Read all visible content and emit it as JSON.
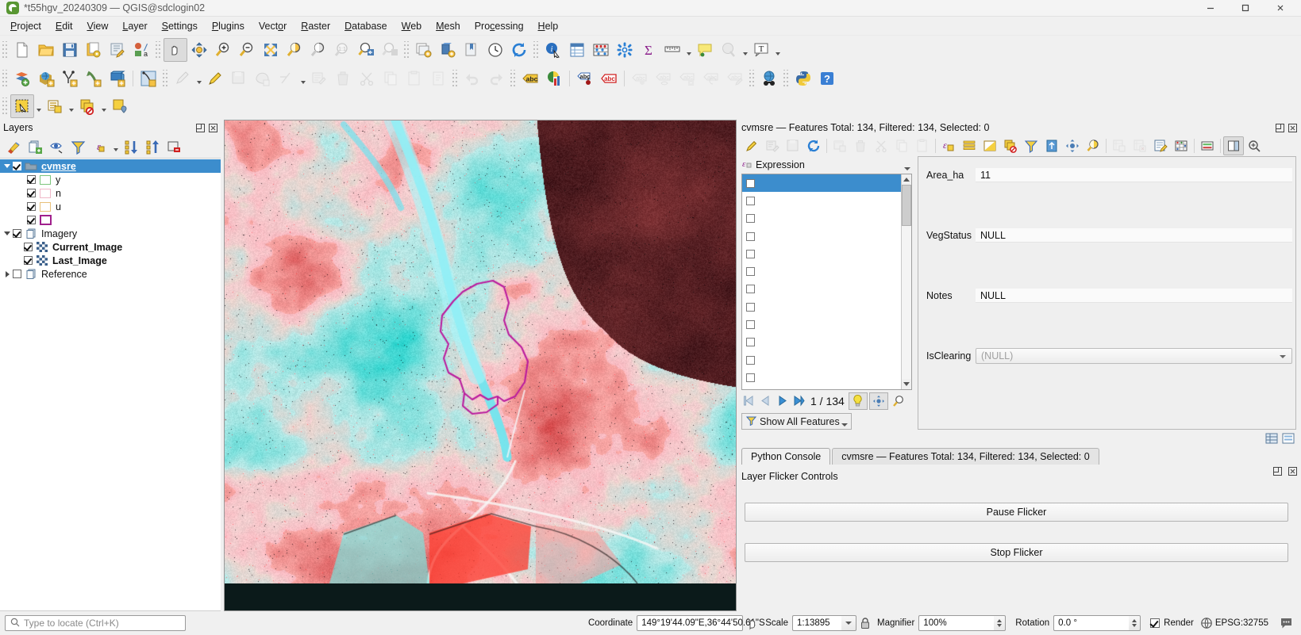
{
  "window": {
    "title": "*t55hgv_20240309 — QGIS@sdclogin02",
    "logo_icon": "qgis-logo-icon",
    "minimize_icon": "minimize-icon",
    "maximize_icon": "maximize-icon",
    "close_icon": "close-icon"
  },
  "menubar": {
    "items": [
      {
        "label": "Project"
      },
      {
        "label": "Edit"
      },
      {
        "label": "View"
      },
      {
        "label": "Layer"
      },
      {
        "label": "Settings"
      },
      {
        "label": "Plugins"
      },
      {
        "label": "Vector"
      },
      {
        "label": "Raster"
      },
      {
        "label": "Database"
      },
      {
        "label": "Web"
      },
      {
        "label": "Mesh"
      },
      {
        "label": "Processing"
      },
      {
        "label": "Help"
      }
    ]
  },
  "layers_panel": {
    "title": "Layers",
    "undock_icon": "undock-icon",
    "close_icon": "close-panel-icon",
    "toolbar": [
      {
        "icon": "open-layer-styling-icon"
      },
      {
        "icon": "add-group-icon"
      },
      {
        "icon": "manage-map-themes-icon"
      },
      {
        "icon": "filter-legend-icon"
      },
      {
        "icon": "filter-legend-expression-icon"
      },
      {
        "icon": "expand-all-icon"
      },
      {
        "icon": "collapse-all-icon"
      },
      {
        "icon": "remove-layer-icon"
      }
    ],
    "tree": [
      {
        "label": "cvmsre",
        "type": "vector",
        "checked": true,
        "selected": true,
        "expanded": true,
        "level": 0,
        "icon": "vector-layer-icon"
      },
      {
        "label": "y",
        "type": "symbol",
        "checked": true,
        "level": 1,
        "stroke": "#7cc47c"
      },
      {
        "label": "n",
        "type": "symbol",
        "checked": true,
        "level": 1,
        "stroke": "#f0b8c8"
      },
      {
        "label": "u",
        "type": "symbol",
        "checked": true,
        "level": 1,
        "stroke": "#e8c07a"
      },
      {
        "label": "",
        "type": "symbol",
        "checked": true,
        "level": 1,
        "stroke": "#a0208c"
      },
      {
        "label": "Imagery",
        "type": "group",
        "checked": true,
        "expanded": true,
        "level": 0,
        "icon": "group-icon"
      },
      {
        "label": "Current_Image",
        "type": "raster",
        "checked": true,
        "level": 1,
        "bold": true,
        "icon": "raster-layer-icon"
      },
      {
        "label": "Last_Image",
        "type": "raster",
        "checked": true,
        "level": 1,
        "bold": true,
        "icon": "raster-layer-icon"
      },
      {
        "label": "Reference",
        "type": "group",
        "checked": false,
        "expanded": false,
        "level": 0,
        "icon": "group-icon"
      }
    ]
  },
  "attribute_dock": {
    "title": "cvmsre — Features Total: 134, Filtered: 134, Selected: 0",
    "undock_icon": "undock-icon",
    "close_icon": "close-panel-icon",
    "toolbar": [
      {
        "icon": "toggle-editing-icon",
        "enabled": true
      },
      {
        "icon": "save-edits-icon",
        "enabled": false
      },
      {
        "icon": "save-layer-edits-icon",
        "enabled": false
      },
      {
        "icon": "reload-table-icon",
        "enabled": true
      },
      {
        "icon": "add-feature-icon",
        "enabled": false
      },
      {
        "icon": "delete-selected-icon",
        "enabled": false
      },
      {
        "icon": "cut-features-icon",
        "enabled": false
      },
      {
        "icon": "copy-features-icon",
        "enabled": false
      },
      {
        "icon": "paste-features-icon",
        "enabled": false
      },
      {
        "icon": "select-by-expression-icon",
        "enabled": true
      },
      {
        "icon": "select-all-icon",
        "enabled": true
      },
      {
        "icon": "invert-selection-icon",
        "enabled": true
      },
      {
        "icon": "deselect-all-icon",
        "enabled": true
      },
      {
        "icon": "filter-features-icon",
        "enabled": true
      },
      {
        "icon": "move-selection-to-top-icon",
        "enabled": true
      },
      {
        "icon": "pan-map-to-feature-icon",
        "enabled": true
      },
      {
        "icon": "zoom-to-selection-icon",
        "enabled": true
      },
      {
        "icon": "new-field-icon",
        "enabled": false
      },
      {
        "icon": "delete-field-icon",
        "enabled": false
      },
      {
        "icon": "field-calculator-icon",
        "enabled": true
      },
      {
        "icon": "conditional-formatting-icon",
        "enabled": true
      },
      {
        "icon": "form-view-icon",
        "enabled": true
      },
      {
        "icon": "dock-toggle-icon",
        "enabled": true
      }
    ],
    "expression_label": "Expression",
    "expression_icon": "expression-icon",
    "feature_rows": 12,
    "selected_row_index": 0,
    "navigation": {
      "first_icon": "first-feature-icon",
      "previous_icon": "previous-feature-icon",
      "next_icon": "next-feature-icon",
      "last_icon": "last-feature-icon",
      "counter": "1 / 134",
      "highlight_icon": "bulb-icon",
      "pan_icon": "pan-to-feature-icon",
      "zoom_icon": "zoom-to-feature-icon"
    },
    "show_all_features": {
      "label": "Show All Features",
      "icon": "filter-icon"
    },
    "form": {
      "fields": [
        {
          "label": "Area_ha",
          "value": "11",
          "type": "text"
        },
        {
          "label": "VegStatus",
          "value": "NULL",
          "type": "text"
        },
        {
          "label": "Notes",
          "value": "NULL",
          "type": "text"
        },
        {
          "label": "IsClearing",
          "value": "(NULL)",
          "type": "combo",
          "placeholder": true
        }
      ]
    },
    "bottom_icons": [
      {
        "icon": "table-view-icon"
      },
      {
        "icon": "form-view-icon"
      }
    ]
  },
  "bottom_tabs": {
    "tabs": [
      {
        "label": "Python Console",
        "active": false
      },
      {
        "label": "cvmsre — Features Total: 134, Filtered: 134, Selected: 0",
        "active": true
      }
    ]
  },
  "flicker_panel": {
    "title": "Layer Flicker Controls",
    "pause_button": "Pause Flicker",
    "stop_button": "Stop Flicker",
    "undock_icon": "undock-icon",
    "close_icon": "close-panel-icon"
  },
  "statusbar": {
    "locator_placeholder": "Type to locate (Ctrl+K)",
    "locator_icon": "search-icon",
    "coordinate_label": "Coordinate",
    "coordinate_value": "149°19'44.09\"E,36°44'50.61\"S",
    "coordinate_toggle_icon": "coordinate-capture-icon",
    "scale_label": "Scale",
    "scale_value": "1:13895",
    "lock_icon": "lock-scale-icon",
    "magnifier_label": "Magnifier",
    "magnifier_value": "100%",
    "rotation_label": "Rotation",
    "rotation_value": "0.0 °",
    "render_label": "Render",
    "render_checked": true,
    "crs_label": "EPSG:32755",
    "crs_icon": "crs-globe-icon",
    "messages_icon": "messages-icon"
  },
  "toolbars": {
    "row1": [
      {
        "icon": "new-project-icon"
      },
      {
        "icon": "open-project-icon"
      },
      {
        "icon": "save-project-icon"
      },
      {
        "icon": "new-print-layout-icon"
      },
      {
        "icon": "style-manager-icon"
      },
      {
        "icon": "data-source-manager-icon"
      },
      {
        "icon": "pan-map-icon",
        "active": true
      },
      {
        "icon": "pan-to-selection-icon"
      },
      {
        "icon": "zoom-in-icon"
      },
      {
        "icon": "zoom-out-icon"
      },
      {
        "icon": "zoom-full-icon"
      },
      {
        "icon": "zoom-to-selection-icon"
      },
      {
        "icon": "zoom-to-layer-icon"
      },
      {
        "icon": "zoom-native-icon",
        "enabled": false
      },
      {
        "icon": "zoom-last-icon"
      },
      {
        "icon": "zoom-next-icon",
        "enabled": false
      },
      {
        "icon": "new-map-view-icon"
      },
      {
        "icon": "new-3d-map-view-icon"
      },
      {
        "icon": "show-bookmarks-icon"
      },
      {
        "icon": "temporal-controller-icon"
      },
      {
        "icon": "refresh-icon"
      },
      {
        "icon": "identify-features-icon"
      },
      {
        "icon": "open-attribute-table-icon"
      },
      {
        "icon": "statistical-summary-icon"
      },
      {
        "icon": "processing-toolbox-icon"
      },
      {
        "icon": "sum-icon"
      },
      {
        "icon": "measure-line-icon"
      },
      {
        "icon": "map-tips-icon"
      },
      {
        "icon": "annotations-icon",
        "enabled": false
      },
      {
        "icon": "text-annotation-icon"
      }
    ],
    "row2": [
      {
        "icon": "add-vector-layer-icon"
      },
      {
        "icon": "add-wms-layer-icon"
      },
      {
        "icon": "add-delimited-text-layer-icon"
      },
      {
        "icon": "add-virtual-layer-icon"
      },
      {
        "icon": "add-mesh-layer-icon"
      },
      {
        "icon": "add-point-cloud-layer-icon"
      },
      {
        "icon": "current-edits-icon",
        "enabled": false
      },
      {
        "icon": "toggle-editing-icon"
      },
      {
        "icon": "save-layer-edits-icon",
        "enabled": false
      },
      {
        "icon": "add-polygon-feature-icon",
        "enabled": false
      },
      {
        "icon": "vertex-tool-icon",
        "enabled": false
      },
      {
        "icon": "modify-attributes-icon",
        "enabled": false
      },
      {
        "icon": "delete-selected-icon",
        "enabled": false
      },
      {
        "icon": "cut-features-icon",
        "enabled": false
      },
      {
        "icon": "copy-features-icon",
        "enabled": false
      },
      {
        "icon": "paste-features-icon",
        "enabled": false
      },
      {
        "icon": "undo-icon",
        "enabled": false
      },
      {
        "icon": "redo-icon",
        "enabled": false
      },
      {
        "icon": "label-toolbar-icon"
      },
      {
        "icon": "diagram-icon"
      },
      {
        "icon": "pin-labels-icon"
      },
      {
        "icon": "highlight-labels-icon"
      },
      {
        "icon": "move-label-icon",
        "enabled": false
      },
      {
        "icon": "show-hide-labels-icon",
        "enabled": false
      },
      {
        "icon": "rotate-label-icon",
        "enabled": false
      },
      {
        "icon": "change-label-icon",
        "enabled": false
      },
      {
        "icon": "edit-label-icon",
        "enabled": false
      },
      {
        "icon": "metasearch-icon"
      },
      {
        "icon": "python-console-icon"
      },
      {
        "icon": "help-icon"
      }
    ],
    "row3": [
      {
        "icon": "select-features-icon",
        "active": true
      },
      {
        "icon": "select-by-form-icon"
      },
      {
        "icon": "deselect-features-icon"
      },
      {
        "icon": "select-value-icon"
      }
    ]
  }
}
